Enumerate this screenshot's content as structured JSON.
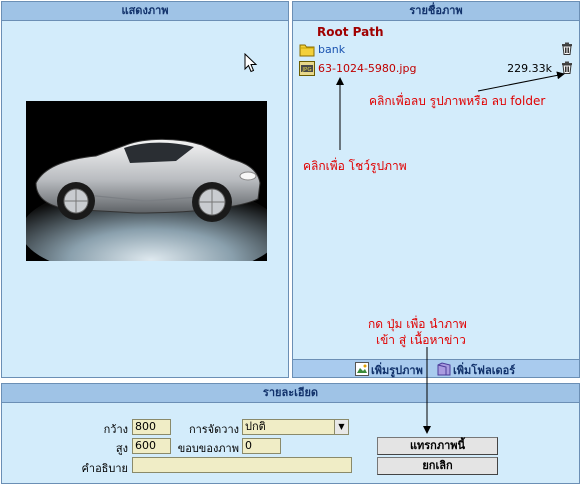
{
  "preview": {
    "header": "แสดงภาพ"
  },
  "files": {
    "header": "รายชื่อภาพ",
    "root_path": "Root Path",
    "items": [
      {
        "type": "folder",
        "name": "bank",
        "size": ""
      },
      {
        "type": "image",
        "name": "63-1024-5980.jpg",
        "size": "229.33k"
      }
    ],
    "footer": {
      "add_image": "เพิ่มรูปภาพ",
      "add_folder": "เพิ่มโฟลเดอร์"
    }
  },
  "annotations": {
    "delete_note": "คลิกเพื่อลบ รูปภาพหรือ ลบ folder",
    "show_note": "คลิกเพื่อ โชว์รูปภาพ",
    "insert_note_line1": "กด ปุ่ม เพื่อ นำภาพ",
    "insert_note_line2": "เข้า สู่ เนื้อหาข่าว"
  },
  "details": {
    "header": "รายละเอียด",
    "width_label": "กว้าง",
    "width_value": "800",
    "height_label": "สูง",
    "height_value": "600",
    "align_label": "การจัดวาง",
    "align_value": "ปกติ",
    "border_label": "ขอบของภาพ",
    "border_value": "0",
    "caption_label": "คำอธิบาย",
    "caption_value": "",
    "insert_button": "แทรกภาพนี้",
    "cancel_button": "ยกเลิก"
  },
  "colors": {
    "panel_bg": "#d3ecfb",
    "header_bg": "#9fc3e6",
    "note_red": "#e00000",
    "field_bg": "#f0edc6"
  }
}
